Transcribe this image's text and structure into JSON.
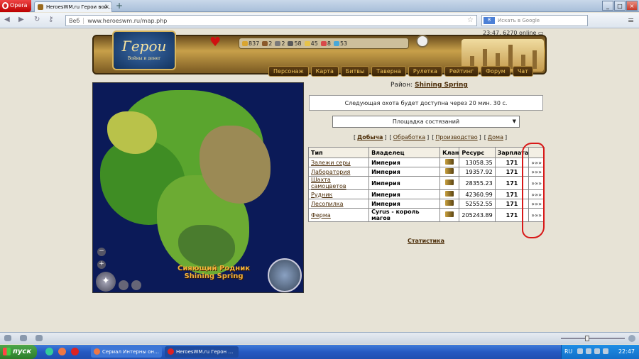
{
  "browser": {
    "opera_label": "Opera",
    "tab_title": "HeroesWM.ru Герои вой…",
    "tab_close": "×",
    "new_tab": "+",
    "url_prefix": "Веб",
    "url": "www.heroeswm.ru/map.php",
    "search_placeholder": "Искать в Google",
    "search_engine": "8"
  },
  "header": {
    "logo_title": "Герои",
    "logo_subtitle": "Войны и денег",
    "time_online": "23:47, 6270 online",
    "resources": [
      {
        "value": "837",
        "color": "#d9a531",
        "icon": "gold-icon"
      },
      {
        "value": "2",
        "color": "#8b5a2b",
        "icon": "wood-icon"
      },
      {
        "value": "2",
        "color": "#7a7a7a",
        "icon": "ore-icon"
      },
      {
        "value": "58",
        "color": "#5a5a5a",
        "icon": "mercury-icon"
      },
      {
        "value": "45",
        "color": "#e6c34a",
        "icon": "sulfur-icon"
      },
      {
        "value": "8",
        "color": "#d84a4a",
        "icon": "crystal-icon"
      },
      {
        "value": "53",
        "color": "#48a8d8",
        "icon": "gem-icon"
      }
    ],
    "nav": [
      "Персонаж",
      "Карта",
      "Битвы",
      "Таверна",
      "Рулетка",
      "Рейтинг",
      "Форум",
      "Чат"
    ]
  },
  "map": {
    "label_ru": "Сияющий Родник",
    "label_en": "Shining Spring"
  },
  "district": {
    "label": "Район:",
    "name": "Shining Spring"
  },
  "hunt_notice": "Следующая охота будет доступна через 20 мин. 30 с.",
  "arena_select": "Площадка состязаний",
  "job_tabs": [
    {
      "label": "Добыча",
      "active": true
    },
    {
      "label": "Обработка",
      "active": false
    },
    {
      "label": "Производство",
      "active": false
    },
    {
      "label": "Дома",
      "active": false
    }
  ],
  "table": {
    "headers": [
      "Тип",
      "Владелец",
      "Клан",
      "Ресурс",
      "Зарплата",
      ""
    ],
    "rows": [
      {
        "type": "Залежи серы",
        "owner": "Империя",
        "clan": "clan-icon",
        "resource": "13058.35",
        "salary": "171",
        "action": "»»»"
      },
      {
        "type": "Лаборатория",
        "owner": "Империя",
        "clan": "clan-icon",
        "resource": "19357.92",
        "salary": "171",
        "action": "»»»"
      },
      {
        "type": "Шахта самоцветов",
        "owner": "Империя",
        "clan": "clan-icon-bt",
        "resource": "28355.23",
        "salary": "171",
        "action": "»»»"
      },
      {
        "type": "Рудник",
        "owner": "Империя",
        "clan": "clan-icon",
        "resource": "42360.99",
        "salary": "171",
        "action": "»»»"
      },
      {
        "type": "Лесопилка",
        "owner": "Империя",
        "clan": "clan-icon-bt",
        "resource": "52552.55",
        "salary": "171",
        "action": "»»»"
      },
      {
        "type": "Ферма",
        "owner": "Cyrus - король магов",
        "clan": "clan-icon",
        "resource": "205243.89",
        "salary": "171",
        "action": "»»»"
      }
    ]
  },
  "stats_link": "Статистика",
  "taskbar": {
    "start": "пуск",
    "tasks": [
      "Сериал Интерны он…",
      "HeroesWM.ru Герон …"
    ],
    "lang": "RU",
    "clock": "22:47"
  }
}
